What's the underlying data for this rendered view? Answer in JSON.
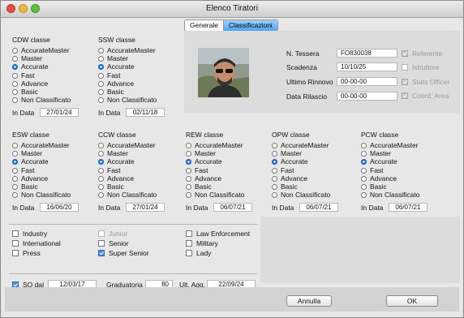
{
  "window": {
    "title": "Elenco Tiratori"
  },
  "tabs": [
    {
      "label": "Generale",
      "active": false
    },
    {
      "label": "Classificazioni",
      "active": true
    }
  ],
  "levels": [
    "AccurateMaster",
    "Master",
    "Accurate",
    "Fast",
    "Advance",
    "Basic",
    "Non Classificato"
  ],
  "in_data_label": "In Data",
  "classes": {
    "cdw": {
      "title": "CDW classe",
      "selected": "Accurate",
      "date": "27/01/24"
    },
    "ssw": {
      "title": "SSW classe",
      "selected": "Accurate",
      "date": "02/11/18"
    },
    "esw": {
      "title": "ESW classe",
      "selected": "Accurate",
      "date": "16/06/20"
    },
    "ccw": {
      "title": "CCW classe",
      "selected": "Accurate",
      "date": "27/01/24"
    },
    "rew": {
      "title": "REW classe",
      "selected": "Accurate",
      "date": "06/07/21"
    },
    "opw": {
      "title": "OPW classe",
      "selected": "Accurate",
      "date": "06/07/21"
    },
    "pcw": {
      "title": "PCW classe",
      "selected": "Accurate",
      "date": "06/07/21"
    }
  },
  "member": {
    "tessera_label": "N. Tessera",
    "tessera": "FO830038",
    "scadenza_label": "Scadenza",
    "scadenza": "10/10/25",
    "rinnovo_label": "Ultimo Rinnovo",
    "rinnovo": "00-00-00",
    "rilascio_label": "Data Rilascio",
    "rilascio": "00-00-00"
  },
  "roles": {
    "referente": {
      "label": "Referente",
      "checked": true
    },
    "istruttore": {
      "label": "Istruttore",
      "checked": false
    },
    "stats_officer": {
      "label": "Stats Officer",
      "checked": true
    },
    "coord_area": {
      "label": "Coord. Area",
      "checked": true
    }
  },
  "categories": {
    "industry": {
      "label": "Industry",
      "checked": false
    },
    "international": {
      "label": "International",
      "checked": false
    },
    "press": {
      "label": "Press",
      "checked": false
    },
    "junior": {
      "label": "Junior",
      "checked": false
    },
    "senior": {
      "label": "Senior",
      "checked": false
    },
    "super_senior": {
      "label": "Super Senior",
      "checked": true
    },
    "law": {
      "label": "Law Enforcement",
      "checked": false
    },
    "military": {
      "label": "Military",
      "checked": false
    },
    "lady": {
      "label": "Lady",
      "checked": false
    }
  },
  "footer": {
    "so_dal_label": "SO dal",
    "so_dal_checked": true,
    "so_dal": "12/03/17",
    "graduatoria_label": "Graduatoria",
    "graduatoria": "80",
    "ult_agg_label": "Ult. Agg.",
    "ult_agg": "22/09/24"
  },
  "buttons": {
    "cancel": "Annulla",
    "ok": "OK"
  }
}
